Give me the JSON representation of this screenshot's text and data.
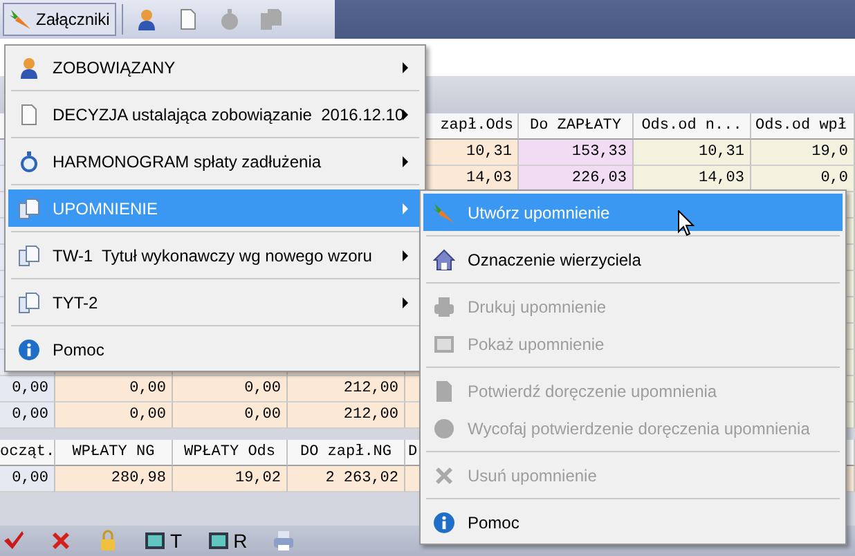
{
  "toolbar": {
    "attachments_button": {
      "label": "Załączniki",
      "pressed": true
    },
    "icon_buttons": [
      {
        "disabled": false
      },
      {
        "disabled": false
      },
      {
        "disabled": true
      },
      {
        "disabled": true
      }
    ]
  },
  "table": {
    "columns": [
      "zapł.Ods",
      "Do ZAPŁATY",
      "Ods.od n...",
      "Ods.od wpł"
    ],
    "rows": [
      [
        "10,31",
        "153,33",
        "10,31",
        "19,0"
      ],
      [
        "14,03",
        "226,03",
        "14,03",
        "0,0"
      ]
    ],
    "lower_rows": [
      [
        "0,00",
        "0,00",
        "0,00",
        "212,00"
      ],
      [
        "0,00",
        "0,00",
        "0,00",
        "212,00"
      ]
    ]
  },
  "summary_table": {
    "columns": [
      "ocząt.",
      "WPŁATY NG",
      "WPŁATY Ods",
      "DO zapł.NG",
      "D"
    ],
    "rows": [
      [
        "0,00",
        "280,98",
        "19,02",
        "2 263,02"
      ]
    ]
  },
  "bottom_toolbar": {
    "labels": [
      "T",
      "R"
    ]
  },
  "menu": {
    "items": [
      {
        "kind": "item",
        "label": "ZOBOWIĄZANY",
        "submenu": true,
        "selected": false
      },
      {
        "kind": "separator"
      },
      {
        "kind": "item",
        "label": "DECYZJA ustalająca zobowiązanie  2016.12.10",
        "submenu": true,
        "selected": false
      },
      {
        "kind": "separator"
      },
      {
        "kind": "item",
        "label": "HARMONOGRAM spłaty zadłużenia",
        "submenu": true,
        "selected": false
      },
      {
        "kind": "separator"
      },
      {
        "kind": "item",
        "label": "UPOMNIENIE",
        "submenu": true,
        "selected": true
      },
      {
        "kind": "separator"
      },
      {
        "kind": "item",
        "label": "TW-1  Tytuł wykonawczy wg nowego wzoru",
        "submenu": true,
        "selected": false
      },
      {
        "kind": "separator"
      },
      {
        "kind": "item",
        "label": "TYT-2",
        "submenu": true,
        "selected": false
      },
      {
        "kind": "separator"
      },
      {
        "kind": "item",
        "label": "Pomoc",
        "submenu": false,
        "selected": false
      }
    ]
  },
  "submenu": {
    "items": [
      {
        "kind": "item",
        "label": "Utwórz upomnienie",
        "selected": true,
        "disabled": false
      },
      {
        "kind": "separator"
      },
      {
        "kind": "item",
        "label": "Oznaczenie wierzyciela",
        "selected": false,
        "disabled": false
      },
      {
        "kind": "separator"
      },
      {
        "kind": "item",
        "label": "Drukuj upomnienie",
        "selected": false,
        "disabled": true
      },
      {
        "kind": "item",
        "label": "Pokaż upomnienie",
        "selected": false,
        "disabled": true
      },
      {
        "kind": "separator"
      },
      {
        "kind": "item",
        "label": "Potwierdź doręczenie upomnienia",
        "selected": false,
        "disabled": true
      },
      {
        "kind": "item",
        "label": "Wycofaj potwierdzenie doręczenia upomnienia",
        "selected": false,
        "disabled": true
      },
      {
        "kind": "separator"
      },
      {
        "kind": "item",
        "label": "Usuń upomnienie",
        "selected": false,
        "disabled": true
      },
      {
        "kind": "separator"
      },
      {
        "kind": "item",
        "label": "Pomoc",
        "selected": false,
        "disabled": false
      }
    ]
  }
}
